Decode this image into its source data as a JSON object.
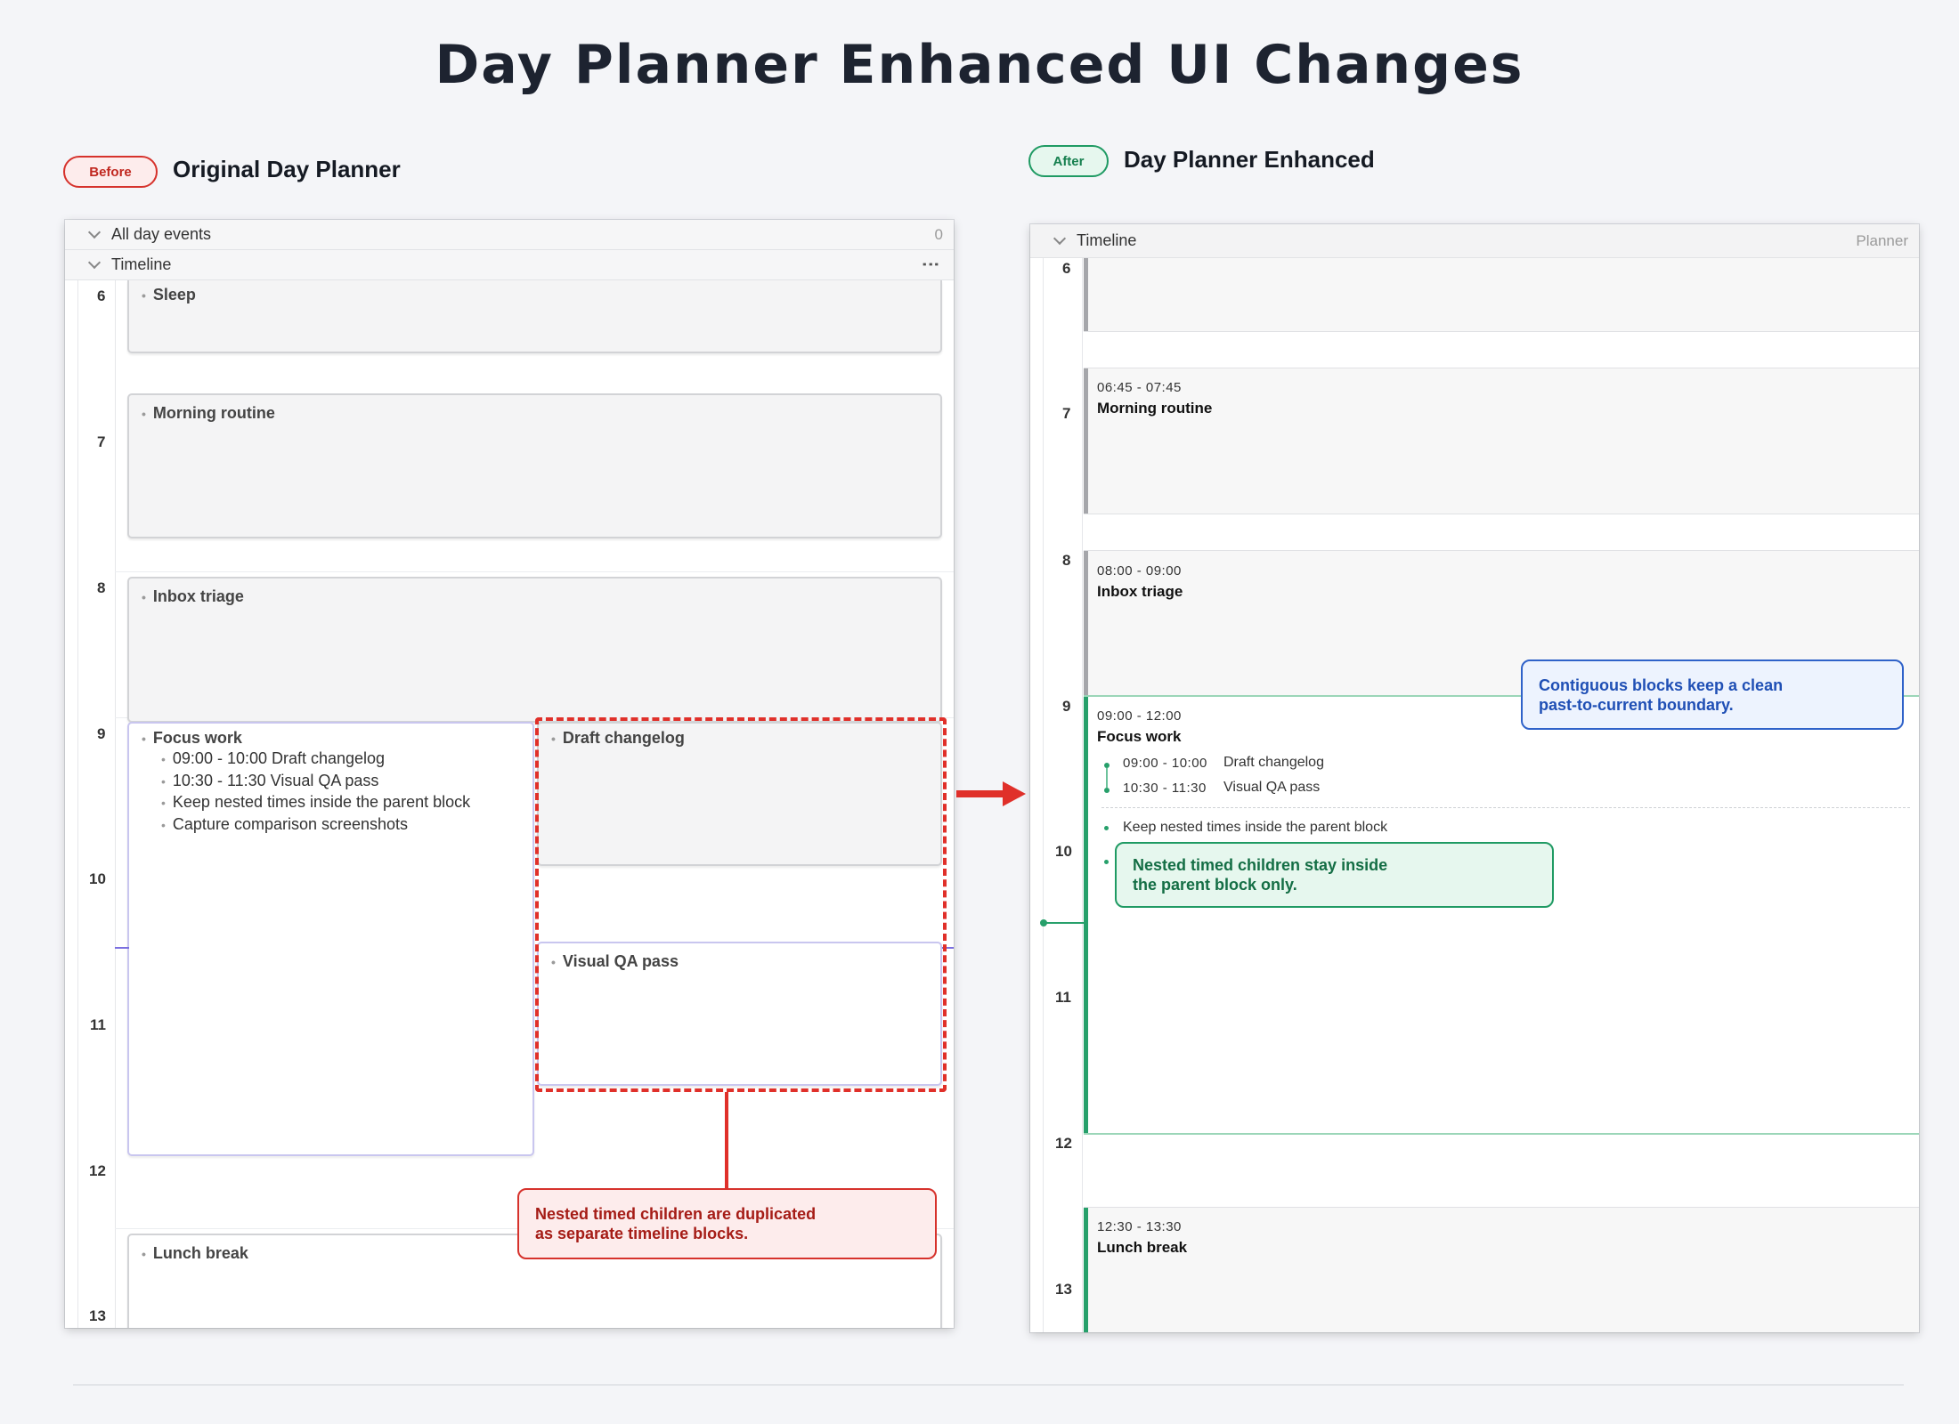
{
  "page": {
    "title": "Day Planner Enhanced UI Changes"
  },
  "before": {
    "badge": "Before",
    "title": "Original Day Planner",
    "all_day_label": "All day events",
    "all_day_count": "0",
    "timeline_label": "Timeline",
    "kebab": "⋮",
    "hours": [
      "6",
      "7",
      "8",
      "9",
      "10",
      "11",
      "12",
      "13"
    ],
    "blocks": {
      "sleep": "Sleep",
      "morning": "Morning routine",
      "inbox": "Inbox triage",
      "focus": "Focus work",
      "focus_items": [
        "09:00 - 10:00 Draft changelog",
        "10:30 - 11:30 Visual QA pass",
        "Keep nested times inside the parent block",
        "Capture comparison screenshots"
      ],
      "draft": "Draft changelog",
      "visual_qa": "Visual QA pass",
      "lunch": "Lunch break"
    },
    "callout": [
      "Nested timed children are duplicated",
      "as separate timeline blocks."
    ]
  },
  "after": {
    "badge": "After",
    "title": "Day Planner Enhanced",
    "timeline_label": "Timeline",
    "planner_label": "Planner",
    "hours": [
      "6",
      "7",
      "8",
      "9",
      "10",
      "11",
      "12",
      "13"
    ],
    "blocks": {
      "morning": {
        "time": "06:45 - 07:45",
        "name": "Morning routine"
      },
      "inbox": {
        "time": "08:00 - 09:00",
        "name": "Inbox triage"
      },
      "focus": {
        "time": "09:00 - 12:00",
        "name": "Focus work",
        "children": [
          {
            "time": "09:00 - 10:00",
            "name": "Draft changelog"
          },
          {
            "time": "10:30 - 11:30",
            "name": "Visual QA pass"
          }
        ],
        "note": "Keep nested times inside the parent block"
      },
      "lunch": {
        "time": "12:30 - 13:30",
        "name": "Lunch break"
      }
    },
    "callout_blue": [
      "Contiguous blocks keep a clean",
      "past-to-current boundary."
    ],
    "callout_green": [
      "Nested timed children stay inside",
      "the parent block only."
    ]
  },
  "colors": {
    "before_accent": "#d6322c",
    "after_accent": "#1f9a63",
    "current_time": "#27a06b",
    "focus_border": "#c9c6ef"
  }
}
